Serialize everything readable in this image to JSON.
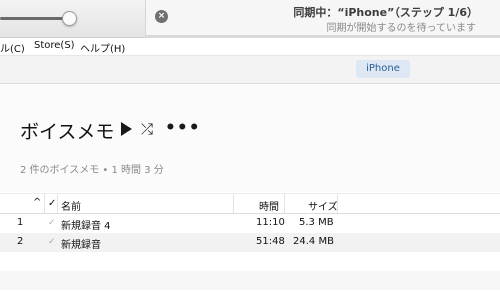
{
  "sync": {
    "cancel_glyph": "×",
    "title": "同期中：“iPhone”（ステップ 1/6）",
    "subtitle": "同期が開始するのを待っています",
    "progress_fraction": 0.0
  },
  "menu": {
    "items": [
      "ル(C)",
      "Store(S)",
      "ヘルプ(H)"
    ]
  },
  "device": {
    "button_label": "iPhone"
  },
  "library": {
    "title": "ボイスメモ",
    "play_glyph": "▶",
    "shuffle_glyph": "⤮",
    "more_glyph": "•••",
    "summary": "2 件のボイスメモ • 1 時間 3 分"
  },
  "table": {
    "headers": {
      "sort_glyph": "^",
      "check": "✓",
      "name": "名前",
      "time": "時間",
      "size": "サイズ"
    },
    "rows": [
      {
        "index": "1",
        "check": "✓",
        "name": "新規録音 4",
        "time": "11:10",
        "size": "5.3 MB"
      },
      {
        "index": "2",
        "check": "✓",
        "name": "新規録音",
        "time": "51:48",
        "size": "24.4 MB"
      }
    ]
  },
  "colors": {
    "accent": "#1f7fe0",
    "device_button_bg": "#dde8f4",
    "device_button_text": "#2b5f99"
  }
}
